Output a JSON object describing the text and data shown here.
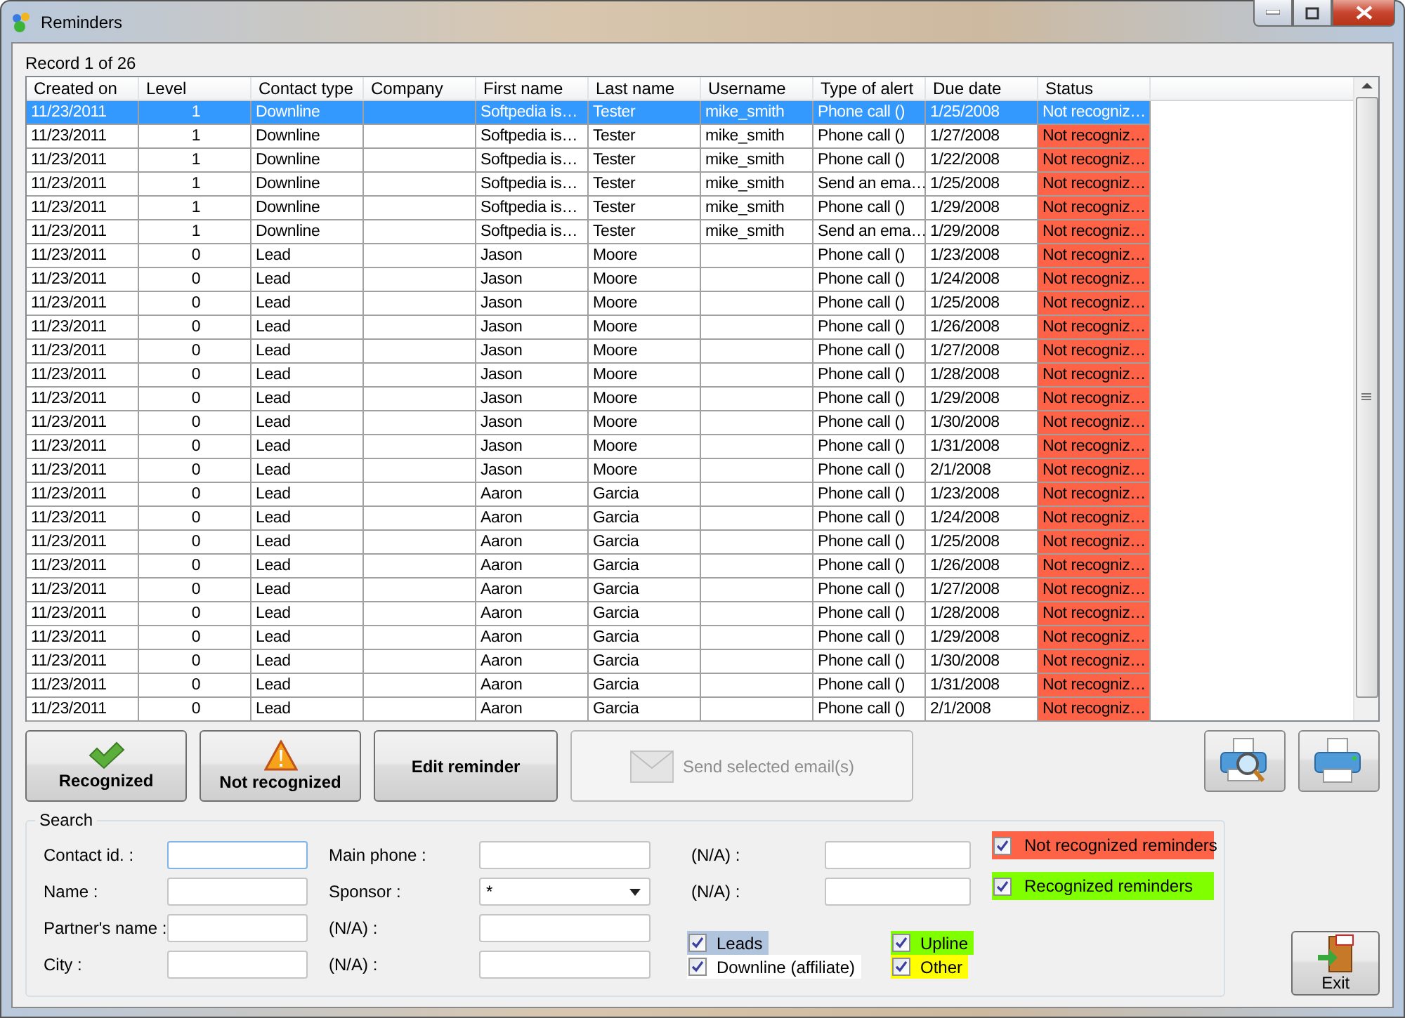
{
  "window": {
    "title": "Reminders"
  },
  "record_label": "Record 1 of 26",
  "table": {
    "columns": [
      "Created on",
      "Level",
      "Contact type",
      "Company",
      "First name",
      "Last name",
      "Username",
      "Type of alert",
      "Due date",
      "Status"
    ],
    "rows": [
      {
        "selected": true,
        "cells": [
          "11/23/2011",
          "1",
          "Downline",
          "",
          "Softpedia is…",
          "Tester",
          "mike_smith",
          "Phone call ()",
          "1/25/2008",
          "Not recogniz…"
        ]
      },
      {
        "selected": false,
        "color": "#ff6347",
        "cells": [
          "11/23/2011",
          "1",
          "Downline",
          "",
          "Softpedia is…",
          "Tester",
          "mike_smith",
          "Phone call ()",
          "1/27/2008",
          "Not recogniz…"
        ]
      },
      {
        "selected": false,
        "color": "#ff6347",
        "cells": [
          "11/23/2011",
          "1",
          "Downline",
          "",
          "Softpedia is…",
          "Tester",
          "mike_smith",
          "Phone call ()",
          "1/22/2008",
          "Not recogniz…"
        ]
      },
      {
        "selected": false,
        "color": "#ff6347",
        "cells": [
          "11/23/2011",
          "1",
          "Downline",
          "",
          "Softpedia is…",
          "Tester",
          "mike_smith",
          "Send an ema…",
          "1/25/2008",
          "Not recogniz…"
        ]
      },
      {
        "selected": false,
        "color": "#ff6347",
        "cells": [
          "11/23/2011",
          "1",
          "Downline",
          "",
          "Softpedia is…",
          "Tester",
          "mike_smith",
          "Phone call ()",
          "1/29/2008",
          "Not recogniz…"
        ]
      },
      {
        "selected": false,
        "color": "#ff6347",
        "cells": [
          "11/23/2011",
          "1",
          "Downline",
          "",
          "Softpedia is…",
          "Tester",
          "mike_smith",
          "Send an ema…",
          "1/29/2008",
          "Not recogniz…"
        ]
      },
      {
        "selected": false,
        "color": "#ff6347",
        "cells": [
          "11/23/2011",
          "0",
          "Lead",
          "",
          "Jason",
          "Moore",
          "",
          "Phone call ()",
          "1/23/2008",
          "Not recogniz…"
        ]
      },
      {
        "selected": false,
        "color": "#ff6347",
        "cells": [
          "11/23/2011",
          "0",
          "Lead",
          "",
          "Jason",
          "Moore",
          "",
          "Phone call ()",
          "1/24/2008",
          "Not recogniz…"
        ]
      },
      {
        "selected": false,
        "color": "#ff6347",
        "cells": [
          "11/23/2011",
          "0",
          "Lead",
          "",
          "Jason",
          "Moore",
          "",
          "Phone call ()",
          "1/25/2008",
          "Not recogniz…"
        ]
      },
      {
        "selected": false,
        "color": "#ff6347",
        "cells": [
          "11/23/2011",
          "0",
          "Lead",
          "",
          "Jason",
          "Moore",
          "",
          "Phone call ()",
          "1/26/2008",
          "Not recogniz…"
        ]
      },
      {
        "selected": false,
        "color": "#ff6347",
        "cells": [
          "11/23/2011",
          "0",
          "Lead",
          "",
          "Jason",
          "Moore",
          "",
          "Phone call ()",
          "1/27/2008",
          "Not recogniz…"
        ]
      },
      {
        "selected": false,
        "color": "#ff6347",
        "cells": [
          "11/23/2011",
          "0",
          "Lead",
          "",
          "Jason",
          "Moore",
          "",
          "Phone call ()",
          "1/28/2008",
          "Not recogniz…"
        ]
      },
      {
        "selected": false,
        "color": "#ff6347",
        "cells": [
          "11/23/2011",
          "0",
          "Lead",
          "",
          "Jason",
          "Moore",
          "",
          "Phone call ()",
          "1/29/2008",
          "Not recogniz…"
        ]
      },
      {
        "selected": false,
        "color": "#ff6347",
        "cells": [
          "11/23/2011",
          "0",
          "Lead",
          "",
          "Jason",
          "Moore",
          "",
          "Phone call ()",
          "1/30/2008",
          "Not recogniz…"
        ]
      },
      {
        "selected": false,
        "color": "#ff6347",
        "cells": [
          "11/23/2011",
          "0",
          "Lead",
          "",
          "Jason",
          "Moore",
          "",
          "Phone call ()",
          "1/31/2008",
          "Not recogniz…"
        ]
      },
      {
        "selected": false,
        "color": "#ff6347",
        "cells": [
          "11/23/2011",
          "0",
          "Lead",
          "",
          "Jason",
          "Moore",
          "",
          "Phone call ()",
          "2/1/2008",
          "Not recogniz…"
        ]
      },
      {
        "selected": false,
        "color": "#ff6347",
        "cells": [
          "11/23/2011",
          "0",
          "Lead",
          "",
          "Aaron",
          "Garcia",
          "",
          "Phone call ()",
          "1/23/2008",
          "Not recogniz…"
        ]
      },
      {
        "selected": false,
        "color": "#ff6347",
        "cells": [
          "11/23/2011",
          "0",
          "Lead",
          "",
          "Aaron",
          "Garcia",
          "",
          "Phone call ()",
          "1/24/2008",
          "Not recogniz…"
        ]
      },
      {
        "selected": false,
        "color": "#ff6347",
        "cells": [
          "11/23/2011",
          "0",
          "Lead",
          "",
          "Aaron",
          "Garcia",
          "",
          "Phone call ()",
          "1/25/2008",
          "Not recogniz…"
        ]
      },
      {
        "selected": false,
        "color": "#ff6347",
        "cells": [
          "11/23/2011",
          "0",
          "Lead",
          "",
          "Aaron",
          "Garcia",
          "",
          "Phone call ()",
          "1/26/2008",
          "Not recogniz…"
        ]
      },
      {
        "selected": false,
        "color": "#ff6347",
        "cells": [
          "11/23/2011",
          "0",
          "Lead",
          "",
          "Aaron",
          "Garcia",
          "",
          "Phone call ()",
          "1/27/2008",
          "Not recogniz…"
        ]
      },
      {
        "selected": false,
        "color": "#ff6347",
        "cells": [
          "11/23/2011",
          "0",
          "Lead",
          "",
          "Aaron",
          "Garcia",
          "",
          "Phone call ()",
          "1/28/2008",
          "Not recogniz…"
        ]
      },
      {
        "selected": false,
        "color": "#ff6347",
        "cells": [
          "11/23/2011",
          "0",
          "Lead",
          "",
          "Aaron",
          "Garcia",
          "",
          "Phone call ()",
          "1/29/2008",
          "Not recogniz…"
        ]
      },
      {
        "selected": false,
        "color": "#ff6347",
        "cells": [
          "11/23/2011",
          "0",
          "Lead",
          "",
          "Aaron",
          "Garcia",
          "",
          "Phone call ()",
          "1/30/2008",
          "Not recogniz…"
        ]
      },
      {
        "selected": false,
        "color": "#ff6347",
        "cells": [
          "11/23/2011",
          "0",
          "Lead",
          "",
          "Aaron",
          "Garcia",
          "",
          "Phone call ()",
          "1/31/2008",
          "Not recogniz…"
        ]
      },
      {
        "selected": false,
        "color": "#ff6347",
        "cells": [
          "11/23/2011",
          "0",
          "Lead",
          "",
          "Aaron",
          "Garcia",
          "",
          "Phone call ()",
          "2/1/2008",
          "Not recogniz…"
        ]
      }
    ]
  },
  "buttons": [
    {
      "kind": "recognized",
      "label": "Recognized",
      "disabled": false
    },
    {
      "kind": "not-recognized",
      "label": "Not recognized",
      "disabled": false
    },
    {
      "kind": "edit",
      "label": "Edit reminder",
      "disabled": false
    },
    {
      "kind": "email",
      "label": "Send selected email(s)",
      "disabled": true
    }
  ],
  "search": {
    "title": "Search",
    "columns": [
      [
        {
          "label": "Contact id. :",
          "kind": "text",
          "focused": true
        },
        {
          "label": "Name :",
          "kind": "text",
          "focused": false
        },
        {
          "label": "Partner's name :",
          "kind": "text",
          "focused": false
        },
        {
          "label": "City :",
          "kind": "text",
          "focused": false
        }
      ],
      [
        {
          "label": "Main phone :",
          "kind": "text",
          "focused": false
        },
        {
          "label": "Sponsor :",
          "kind": "dropdown",
          "value": "*",
          "focused": false
        },
        {
          "label": "(N/A) :",
          "kind": "text",
          "focused": false
        },
        {
          "label": "(N/A) :",
          "kind": "text",
          "focused": false
        }
      ],
      [
        {
          "label": "(N/A) :",
          "kind": "text",
          "focused": false
        },
        {
          "label": "(N/A) :",
          "kind": "text",
          "focused": false
        }
      ]
    ],
    "type_filters": [
      {
        "label": "Leads",
        "checked": true,
        "color": "#b0c4de"
      },
      {
        "label": "Downline (affiliate)",
        "checked": true,
        "color": "#ffffff"
      },
      {
        "label": "Upline",
        "checked": true,
        "color": "#7fff00"
      },
      {
        "label": "Other",
        "checked": true,
        "color": "#ffff00"
      }
    ],
    "status_filters": [
      {
        "label": "Not recognized reminders",
        "checked": true,
        "color": "#ff6347"
      },
      {
        "label": "Recognized reminders",
        "checked": true,
        "color": "#7fff00"
      }
    ]
  },
  "exit_button": {
    "label": "Exit"
  }
}
